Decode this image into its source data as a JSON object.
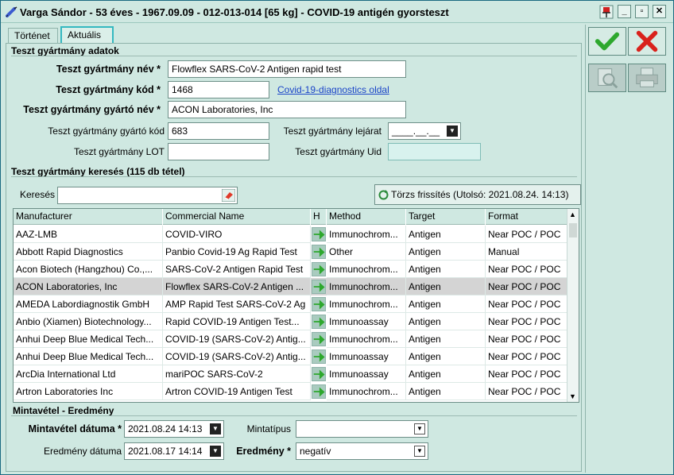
{
  "window": {
    "title": "Varga Sándor - 53 éves - 1967.09.09 - 012-013-014 [65 kg] - COVID-19 antigén gyorsteszt",
    "buttons": {
      "minimize": "_",
      "maximize": "▫",
      "close": "✕"
    }
  },
  "tabs": [
    {
      "label": "Történet",
      "active": false
    },
    {
      "label": "Aktuális",
      "active": true
    }
  ],
  "test_data": {
    "section_title": "Teszt gyártmány adatok",
    "name_label": "Teszt gyártmány név *",
    "name_value": "Flowflex SARS-CoV-2 Antigen rapid test",
    "code_label": "Teszt gyártmány kód *",
    "code_value": "1468",
    "diag_link": "Covid-19-diagnostics oldal",
    "maker_name_label": "Teszt gyártmány gyártó név *",
    "maker_name_value": "ACON Laboratories, Inc",
    "maker_code_label": "Teszt gyártmány gyártó kód",
    "maker_code_value": "683",
    "expiry_label": "Teszt gyártmány lejárat",
    "expiry_value": "____.__.__",
    "lot_label": "Teszt gyártmány LOT",
    "lot_value": "",
    "uid_label": "Teszt gyártmány Uid",
    "uid_value": ""
  },
  "search": {
    "section_title": "Teszt gyártmány keresés (115 db tétel)",
    "label": "Keresés",
    "value": "",
    "refresh_label": "Törzs frissítés (Utolsó: 2021.08.24. 14:13)"
  },
  "grid": {
    "headers": [
      "Manufacturer",
      "Commercial Name",
      "H",
      "Method",
      "Target",
      "Format"
    ],
    "rows": [
      {
        "manufacturer": "AAZ-LMB",
        "name": "COVID-VIRO",
        "method": "Immunochrom...",
        "target": "Antigen",
        "format": "Near POC / POC",
        "selected": false
      },
      {
        "manufacturer": "Abbott Rapid Diagnostics",
        "name": "Panbio Covid-19 Ag Rapid Test",
        "method": "Other",
        "target": "Antigen",
        "format": "Manual",
        "selected": false
      },
      {
        "manufacturer": "Acon Biotech (Hangzhou) Co.,...",
        "name": "SARS-CoV-2 Antigen Rapid Test",
        "method": "Immunochrom...",
        "target": "Antigen",
        "format": "Near POC / POC",
        "selected": false
      },
      {
        "manufacturer": "ACON Laboratories, Inc",
        "name": "Flowflex SARS-CoV-2 Antigen ...",
        "method": "Immunochrom...",
        "target": "Antigen",
        "format": "Near POC / POC",
        "selected": true
      },
      {
        "manufacturer": "AMEDA Labordiagnostik GmbH",
        "name": "AMP Rapid Test SARS-CoV-2 Ag",
        "method": "Immunochrom...",
        "target": "Antigen",
        "format": "Near POC / POC",
        "selected": false
      },
      {
        "manufacturer": "Anbio (Xiamen) Biotechnology...",
        "name": "Rapid COVID-19 Antigen Test...",
        "method": "Immunoassay",
        "target": "Antigen",
        "format": "Near POC / POC",
        "selected": false
      },
      {
        "manufacturer": "Anhui Deep Blue Medical Tech...",
        "name": "COVID-19 (SARS-CoV-2) Antig...",
        "method": "Immunochrom...",
        "target": "Antigen",
        "format": "Near POC / POC",
        "selected": false
      },
      {
        "manufacturer": "Anhui Deep Blue Medical Tech...",
        "name": "COVID-19 (SARS-CoV-2) Antig...",
        "method": "Immunoassay",
        "target": "Antigen",
        "format": "Near POC / POC",
        "selected": false
      },
      {
        "manufacturer": "ArcDia International Ltd",
        "name": "mariPOC SARS-CoV-2",
        "method": "Immunoassay",
        "target": "Antigen",
        "format": "Near POC / POC",
        "selected": false
      },
      {
        "manufacturer": "Artron Laboratories Inc",
        "name": "Artron COVID-19 Antigen Test",
        "method": "Immunochrom...",
        "target": "Antigen",
        "format": "Near POC / POC",
        "selected": false
      }
    ]
  },
  "sample": {
    "section_title": "Mintavétel - Eredmény",
    "date_label": "Mintavétel dátuma *",
    "date_value": "2021.08.24 14:13",
    "type_label": "Mintatípus",
    "type_value": "",
    "result_date_label": "Eredmény dátuma",
    "result_date_value": "2021.08.17 14:14",
    "result_label": "Eredmény *",
    "result_value": "negatív"
  },
  "colors": {
    "accent": "#34b8c0",
    "ok": "#2ea82e",
    "cancel": "#d9221c",
    "link": "#1a44c8"
  },
  "icons": {
    "ok": "checkmark-icon",
    "cancel": "x-icon",
    "preview": "magnifier-icon",
    "print": "printer-icon",
    "row_action": "green-arrow-icon"
  }
}
